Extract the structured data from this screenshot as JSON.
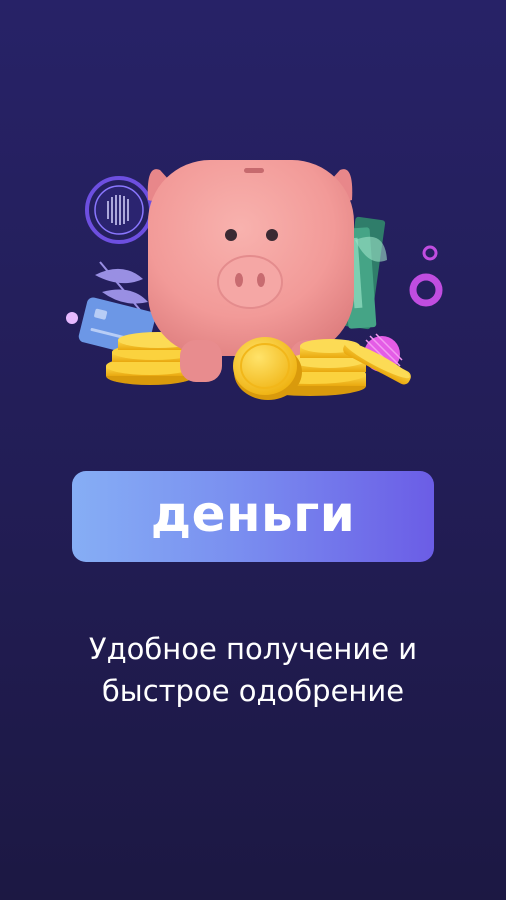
{
  "screen": {
    "background_color": "#241f5c"
  },
  "illustration": {
    "icons": [
      "piggy-bank-icon",
      "coin-stack-icon",
      "bank-card-icon",
      "banknote-icon",
      "leaf-icon",
      "decor-ring-icon"
    ],
    "colors": {
      "piggy": "#f29a98",
      "coin": "#f7c21c",
      "card": "#6c97e6",
      "accent": "#c04de0"
    }
  },
  "brand": {
    "label": "деньги",
    "gradient_start": "#86aef5",
    "gradient_end": "#6b5de6"
  },
  "tagline": {
    "line1": "Удобное получение и",
    "line2": "быстрое одобрение"
  }
}
